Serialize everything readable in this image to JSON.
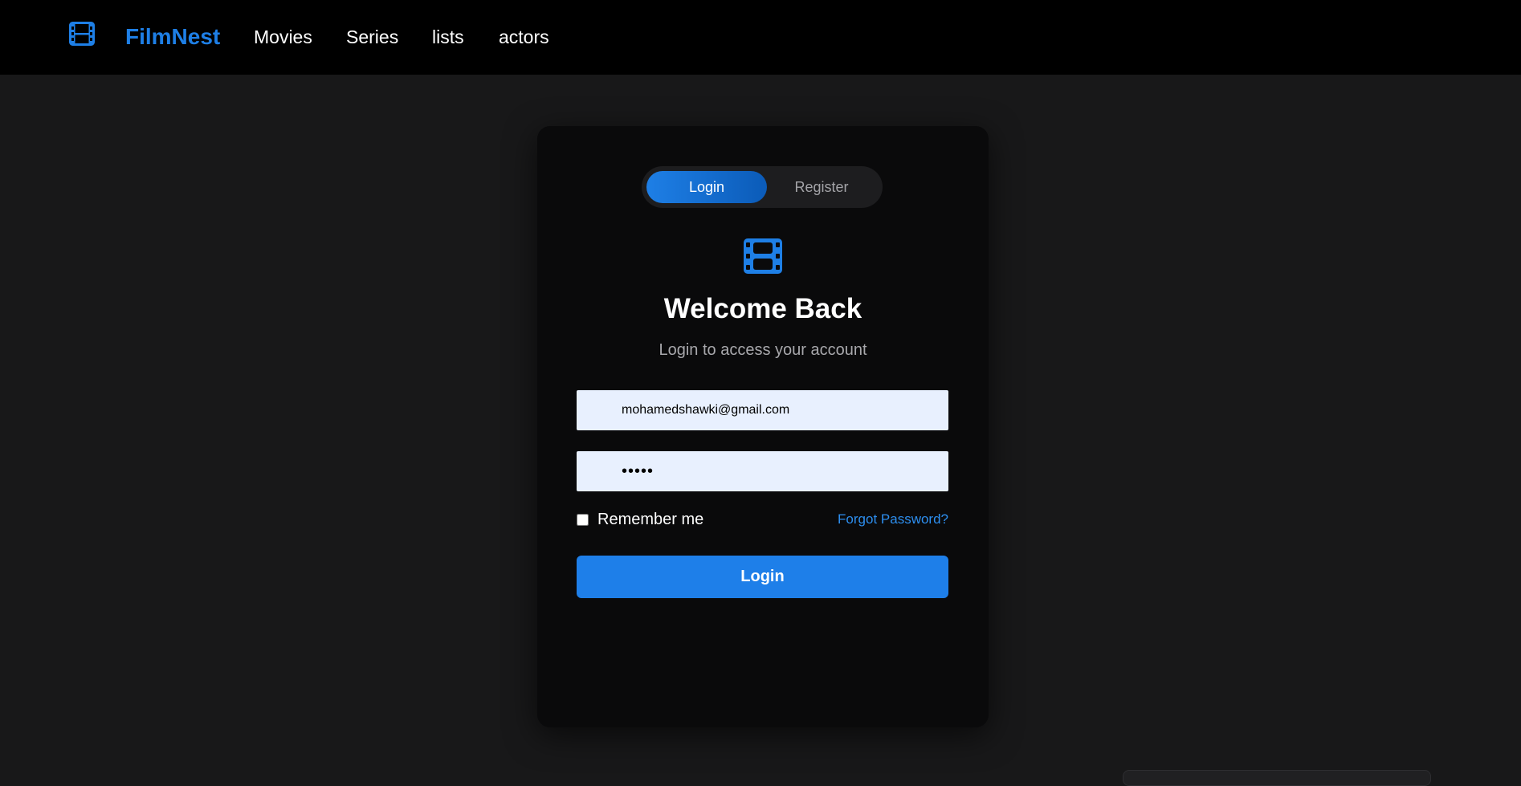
{
  "nav": {
    "logo_icon": "film-icon",
    "brand": "FilmNest",
    "links": [
      "Movies",
      "Series",
      "lists",
      "actors"
    ]
  },
  "auth": {
    "tabs": {
      "login": "Login",
      "register": "Register",
      "active": "Login"
    },
    "icon": "film-icon",
    "title": "Welcome Back",
    "subtitle": "Login to access your account",
    "email_value": "mohamedshawki@gmail.com",
    "password_value": "•••••",
    "remember_label": "Remember me",
    "remember_checked": false,
    "forgot_link": "Forgot Password?",
    "submit_label": "Login"
  },
  "colors": {
    "accent": "#1e7fe6",
    "background": "#181819",
    "card": "#0a0a0b",
    "navbar": "#000000",
    "input_bg": "#e8f0fe"
  }
}
